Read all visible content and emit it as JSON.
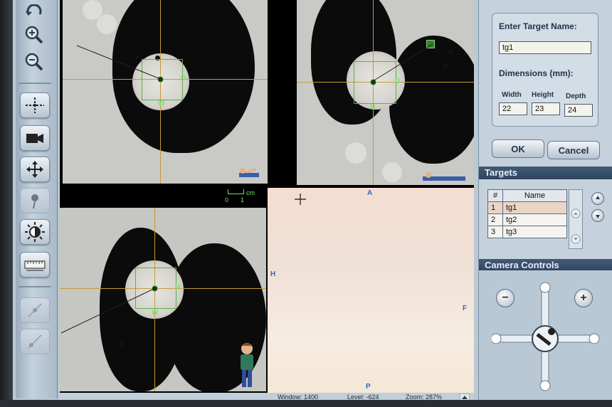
{
  "viewports": {
    "axial_label_d": "D",
    "axial_label_w": "W",
    "sagittal_label_d": "D",
    "sagittal_label_h": "H",
    "coronal_label_h": "H",
    "coronal_label_w": "W",
    "scale_unit": "cm",
    "scale_zero": "0",
    "scale_one": "1",
    "endo_label_top": "A",
    "endo_label_left": "H",
    "endo_label_right": "F",
    "endo_label_bottom": "P"
  },
  "status": {
    "window": "Window: 1400",
    "level": "Level: -624",
    "zoom": "Zoom: 287%"
  },
  "target_form": {
    "name_label": "Enter Target Name:",
    "name_value": "tg1",
    "dimensions_label": "Dimensions (mm):",
    "width_label": "Width",
    "height_label": "Height",
    "depth_label": "Depth",
    "width_value": "22",
    "height_value": "23",
    "depth_value": "24",
    "ok_label": "OK",
    "cancel_label": "Cancel"
  },
  "targets": {
    "title": "Targets",
    "col_num": "#",
    "col_name": "Name",
    "rows": [
      {
        "num": "1",
        "name": "tg1"
      },
      {
        "num": "2",
        "name": "tg2"
      },
      {
        "num": "3",
        "name": "tg3"
      }
    ]
  },
  "camera": {
    "title": "Camera Controls",
    "zoom_out": "−",
    "zoom_in": "+"
  },
  "colors": {
    "crosshair": "#c79b37",
    "target": "#5fae4d",
    "section_header": "#2f4560"
  },
  "icons": [
    "undo-icon",
    "zoom-in-icon",
    "zoom-out-icon",
    "crosshair-icon",
    "camera-icon",
    "pan-icon",
    "probe-icon",
    "brightness-icon",
    "ruler-icon",
    "point-tool-icon",
    "line-tool-icon"
  ]
}
